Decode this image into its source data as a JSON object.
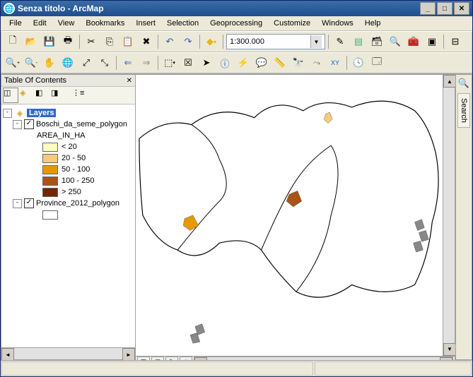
{
  "titlebar": {
    "title": "Senza titolo - ArcMap"
  },
  "menubar": {
    "items": [
      "File",
      "Edit",
      "View",
      "Bookmarks",
      "Insert",
      "Selection",
      "Geoprocessing",
      "Customize",
      "Windows",
      "Help"
    ]
  },
  "toolbar1": {
    "scale_value": "1:300.000",
    "icons": {
      "new": "new-doc-icon",
      "open": "open-icon",
      "save": "save-icon",
      "print": "print-icon",
      "cut": "cut-icon",
      "copy": "copy-icon",
      "paste": "paste-icon",
      "delete": "delete-icon",
      "undo": "undo-icon",
      "redo": "redo-icon",
      "add_data": "add-data-icon",
      "editor": "editor-icon",
      "toc": "toc-icon",
      "catalog": "catalog-icon",
      "search": "search-window-icon",
      "toolbox": "toolbox-icon",
      "python": "python-icon",
      "model": "model-builder-icon"
    }
  },
  "toolbar2": {
    "icons": {
      "zoom_in": "zoom-in-icon",
      "zoom_out": "zoom-out-icon",
      "pan": "pan-icon",
      "full_extent": "full-extent-icon",
      "fixed_in": "fixed-zoom-in-icon",
      "fixed_out": "fixed-zoom-out-icon",
      "prev": "prev-extent-icon",
      "next": "next-extent-icon",
      "select_features": "select-features-icon",
      "clear_sel": "clear-selection-icon",
      "pointer": "pointer-icon",
      "identify": "identify-icon",
      "hyperlink": "hyperlink-icon",
      "popup": "popup-icon",
      "measure": "measure-icon",
      "find": "find-icon",
      "find_route": "find-route-icon",
      "goto_xy": "goto-xy-icon",
      "time": "time-slider-icon",
      "viewer": "viewer-window-icon"
    }
  },
  "toc": {
    "title": "Table Of Contents",
    "toolbar_icons": {
      "by_draw": "list-by-drawing-icon",
      "by_source": "list-by-source-icon",
      "by_vis": "list-by-visibility-icon",
      "by_sel": "list-by-selection-icon",
      "options": "options-icon"
    },
    "dataframe": "Layers",
    "layer1": {
      "name": "Boschi_da_seme_polygon",
      "field": "AREA_IN_HA",
      "checked": true,
      "classes": [
        {
          "label": "< 20",
          "color": "#FFFFBE"
        },
        {
          "label": "20 - 50",
          "color": "#F5CA7A"
        },
        {
          "label": "50 - 100",
          "color": "#E69800"
        },
        {
          "label": "100 - 250",
          "color": "#A85318"
        },
        {
          "label": "> 250",
          "color": "#732600"
        }
      ]
    },
    "layer2": {
      "name": "Province_2012_polygon",
      "checked": true,
      "fill": "#FFFFFF"
    }
  },
  "side_panel": {
    "tab_label": "Search",
    "icon": "search-icon"
  },
  "map_bottom": {
    "data_view": "data-view-icon",
    "layout_view": "layout-view-icon",
    "refresh": "refresh-icon",
    "pause": "pause-icon"
  }
}
